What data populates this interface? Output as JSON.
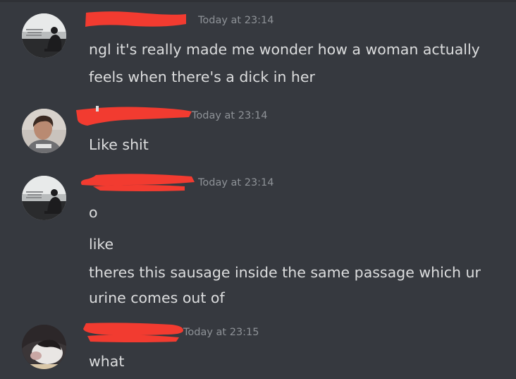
{
  "messages": [
    {
      "timestamp": "Today at 23:14",
      "lines": [
        "ngl it's really made me wonder how a woman actually",
        "feels when there's a dick in her"
      ]
    },
    {
      "timestamp": "Today at 23:14",
      "lines": [
        "Like shit"
      ]
    },
    {
      "timestamp": "Today at 23:14",
      "lines": [
        "o",
        "like",
        "theres this sausage inside the same passage which ur",
        "urine comes out of"
      ]
    },
    {
      "timestamp": "Today at 23:15",
      "lines": [
        "what"
      ]
    }
  ],
  "colors": {
    "background": "#36393f",
    "text": "#dcddde",
    "timestamp": "#8e9297",
    "redaction": "#f23b30"
  },
  "icons": {
    "avatar_1": "avatar-landscape-icon",
    "avatar_2": "avatar-person-icon",
    "avatar_3": "avatar-landscape-icon",
    "avatar_4": "avatar-cat-icon"
  }
}
